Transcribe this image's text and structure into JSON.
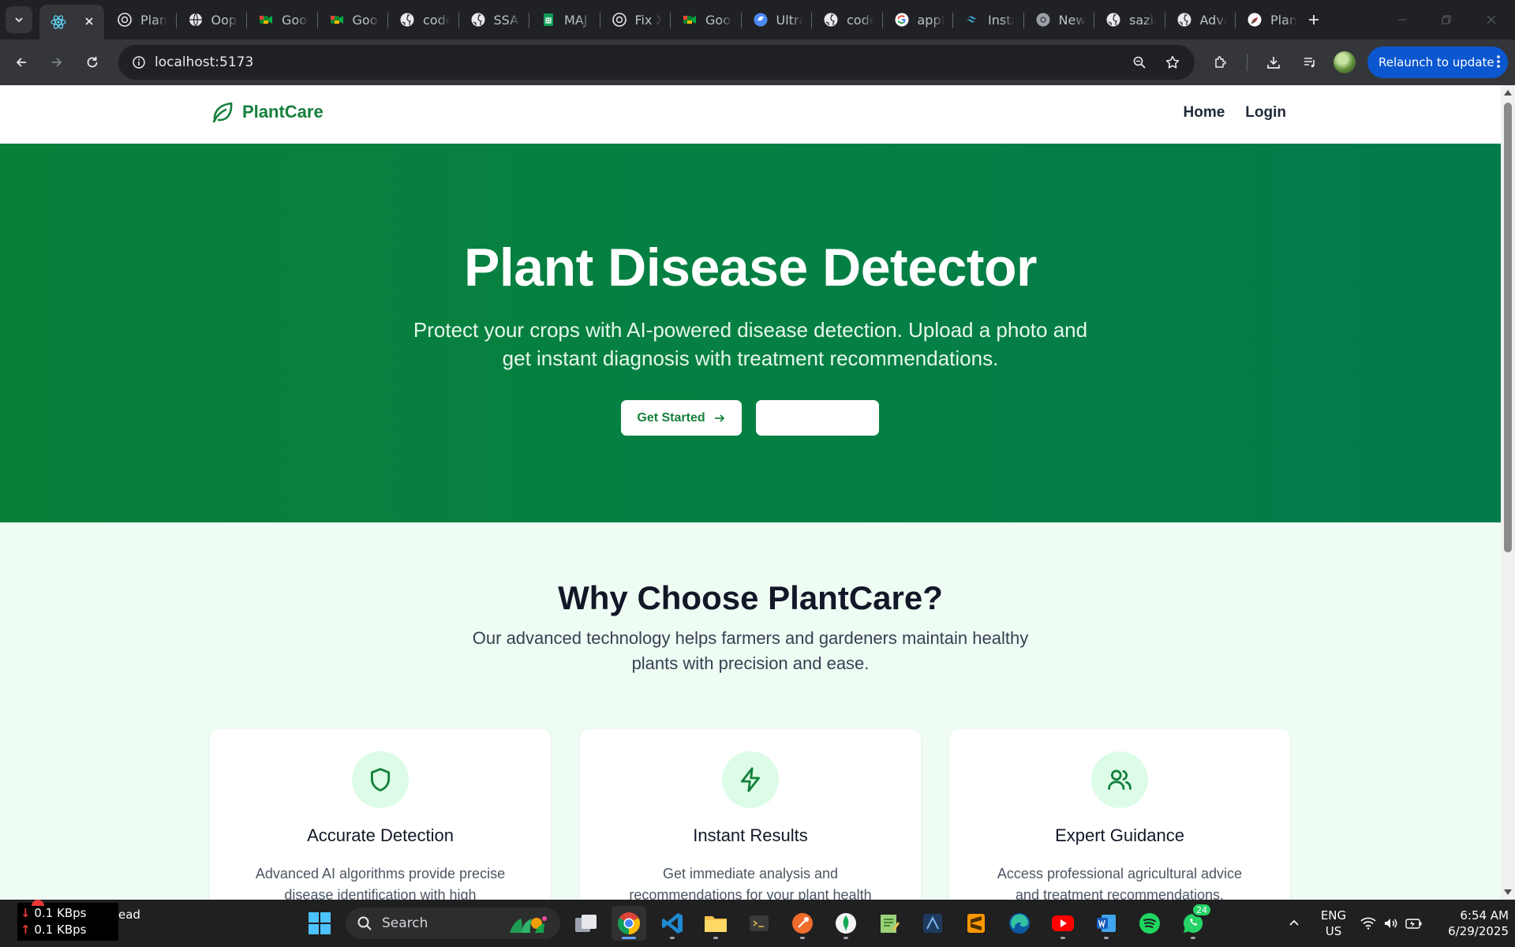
{
  "browser": {
    "tabs": [
      {
        "title": "",
        "icon": "react-icon",
        "active": true
      },
      {
        "title": "Plant",
        "icon": "openai-icon"
      },
      {
        "title": "Oop",
        "icon": "globe-icon"
      },
      {
        "title": "Goo",
        "icon": "google-meet-icon"
      },
      {
        "title": "Goo",
        "icon": "google-meet-icon"
      },
      {
        "title": "code",
        "icon": "github-icon"
      },
      {
        "title": "SSA",
        "icon": "github-icon"
      },
      {
        "title": "MAJ",
        "icon": "google-sheets-icon"
      },
      {
        "title": "Fix X",
        "icon": "openai-icon"
      },
      {
        "title": "Goo",
        "icon": "google-meet-icon"
      },
      {
        "title": "Ultra",
        "icon": "ultra-icon"
      },
      {
        "title": "code",
        "icon": "github-icon"
      },
      {
        "title": "appl",
        "icon": "google-icon"
      },
      {
        "title": "Insta",
        "icon": "tailwind-icon"
      },
      {
        "title": "New",
        "icon": "chrome-icon"
      },
      {
        "title": "sazic",
        "icon": "github-icon"
      },
      {
        "title": "Adva",
        "icon": "github-icon"
      },
      {
        "title": "Plan",
        "icon": "plant-app-icon"
      }
    ],
    "url": "localhost:5173",
    "relaunch_label": "Relaunch to update"
  },
  "site": {
    "brand": "PlantCare",
    "nav": {
      "home": "Home",
      "login": "Login"
    },
    "hero": {
      "title": "Plant Disease Detector",
      "subtitle": "Protect your crops with AI-powered disease detection. Upload a photo and get instant diagnosis with treatment recommendations.",
      "cta_primary": "Get Started",
      "cta_secondary": ""
    },
    "features": {
      "heading": "Why Choose PlantCare?",
      "lead": "Our advanced technology helps farmers and gardeners maintain healthy plants with precision and ease.",
      "cards": [
        {
          "icon": "shield-icon",
          "title": "Accurate Detection",
          "description": "Advanced AI algorithms provide precise disease identification with high"
        },
        {
          "icon": "lightning-icon",
          "title": "Instant Results",
          "description": "Get immediate analysis and recommendations for your plant health"
        },
        {
          "icon": "users-icon",
          "title": "Expert Guidance",
          "description": "Access professional agricultural advice and treatment recommendations."
        }
      ]
    }
  },
  "taskbar": {
    "net_down": "0.1 KBps",
    "net_up": "0.1 KBps",
    "net_label": "ead",
    "search_placeholder": "Search",
    "whatsapp_badge": "24",
    "lang_line1": "ENG",
    "lang_line2": "US",
    "time": "6:54 AM",
    "date": "6/29/2025"
  },
  "colors": {
    "brand_green": "#15803d",
    "hero_green": "#058043",
    "section_bg": "#effcf4",
    "icon_circle_bg": "#dcfce7",
    "relaunch_blue": "#0b57d0"
  }
}
